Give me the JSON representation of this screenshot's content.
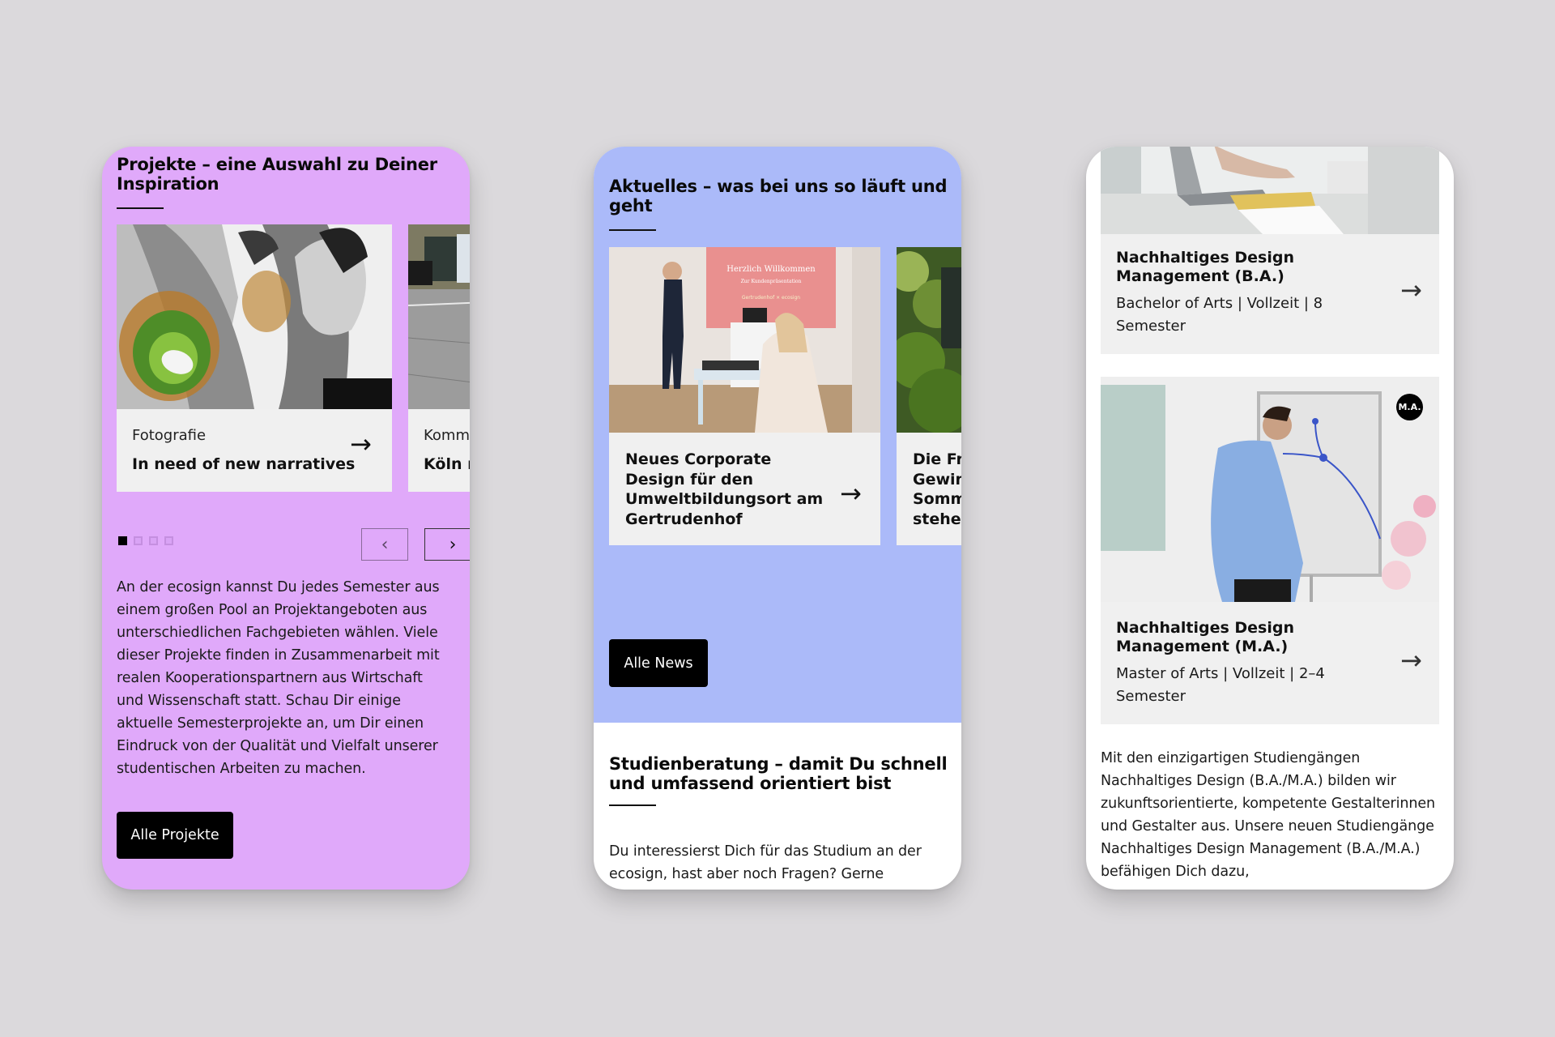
{
  "colors": {
    "background": "#dbd9dc",
    "projects_bg": "#e0a9fa",
    "news_bg": "#abbaf9",
    "card_bg": "#f0f0f0",
    "button_bg": "#000000"
  },
  "projects": {
    "title": "Projekte – eine Auswahl zu Deiner Inspiration",
    "cards": [
      {
        "category": "Fotografie",
        "title": "In need of new narratives",
        "icon": "arrow-right-icon"
      },
      {
        "category": "Komm",
        "title": "Köln r"
      }
    ],
    "pagination": {
      "total": 4,
      "active": 1
    },
    "prev_label": "‹",
    "next_label": "›",
    "body": "An der ecosign kannst Du jedes Semester aus einem großen Pool an Projektangeboten aus unterschiedlichen Fachgebieten wählen. Viele dieser Projekte finden in Zusammenarbeit mit realen Kooperationspartnern aus Wirtschaft und Wissenschaft statt. Schau Dir einige aktuelle Semesterprojekte an, um Dir einen Eindruck von der Qualität und Vielfalt unserer studentischen Arbeiten zu machen.",
    "button_label": "Alle Projekte"
  },
  "news": {
    "title": "Aktuelles – was bei uns so läuft und geht",
    "cards": [
      {
        "title": "Neues Corporate Design für den Umweltbildungsort am Gertrudenhof",
        "image_screen_text": [
          "Herzlich Willkommen",
          "Zur Kundenpräsentation",
          "Gertrudenhof × ecosign"
        ],
        "icon": "arrow-right-icon"
      },
      {
        "title": "Die Fr\nGewin\nSomm\nsteher"
      }
    ],
    "button_label": "Alle News",
    "advice_title": "Studienberatung – damit Du schnell und umfassend orientiert bist",
    "advice_body": "Du interessierst Dich für das Studium an der ecosign, hast aber noch Fragen? Gerne"
  },
  "study": {
    "programs": [
      {
        "title": "Nachhaltiges Design Management (B.A.)",
        "meta": "Bachelor of Arts | Vollzeit | 8 Semester",
        "icon": "arrow-right-icon"
      },
      {
        "title": "Nachhaltiges Design Management (M.A.)",
        "meta": "Master of Arts | Vollzeit | 2–4 Semester",
        "badge": "M.A.",
        "icon": "arrow-right-icon"
      }
    ],
    "body": "Mit den einzigartigen Studiengängen Nachhaltiges Design (B.A./M.A.) bilden wir zukunftsorientierte, kompetente Gestalterinnen und Gestalter aus. Unsere neuen Studiengänge Nachhaltiges Design Management (B.A./M.A.) befähigen Dich dazu,"
  }
}
